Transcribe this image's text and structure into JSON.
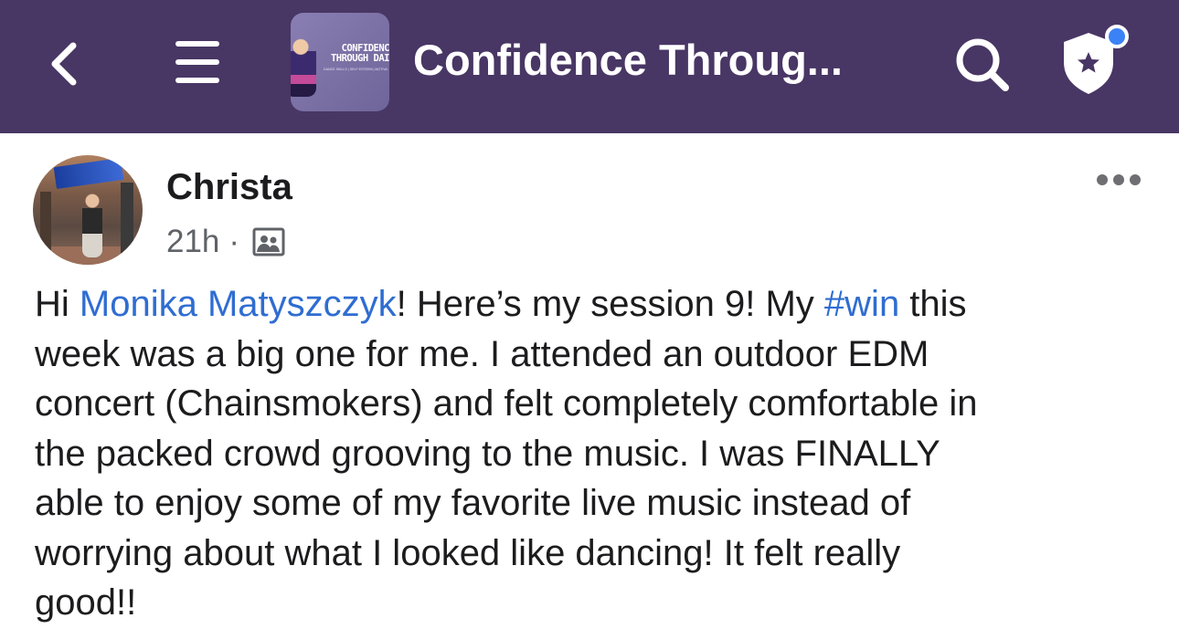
{
  "header": {
    "back_icon": "chevron-left-icon",
    "menu_icon": "hamburger-menu-icon",
    "group_thumbnail": {
      "line1": "CONFIDENC",
      "line2": "THROUGH DAI",
      "subtitle": "DANCE SKILLS | SELF ESTEEM | MOTIVATION | FUN SOCIAL OUTINGS WEEKLY"
    },
    "group_title": "Confidence Throug...",
    "search_icon": "search-icon",
    "shield_icon": "shield-star-icon",
    "has_notification": true
  },
  "post": {
    "author": "Christa",
    "time": "21h",
    "separator": "·",
    "privacy_icon": "group-members-icon",
    "more_icon": "more-horizontal-icon",
    "body": {
      "p1": "Hi ",
      "mention": "Monika Matyszczyk",
      "p2": "! Here’s my session 9! My ",
      "hashtag": "#win",
      "p3": " this\nweek was a big one for me. I attended an outdoor EDM\nconcert (Chainsmokers) and felt completely comfortable in\nthe packed crowd grooving to the music. I was FINALLY\nable to enjoy some of my favorite live music instead of\nworrying about what I looked like dancing! It felt really\ngood!!"
    }
  },
  "colors": {
    "header_bg": "#483664",
    "link": "#2f6dd1",
    "notification_dot": "#3b82f6",
    "meta_text": "#5f6368"
  }
}
